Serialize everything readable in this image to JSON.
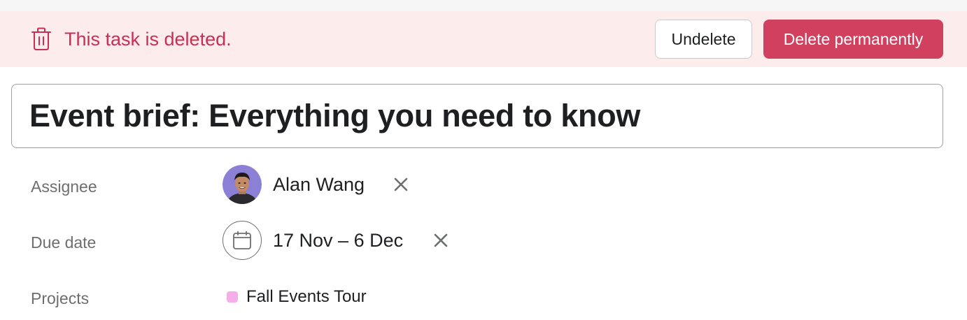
{
  "banner": {
    "message": "This task is deleted.",
    "undelete_label": "Undelete",
    "delete_label": "Delete permanently",
    "icon": "trash-icon",
    "accent_color": "#c92f54",
    "background_color": "#fdecec",
    "delete_button_color": "#d1405f"
  },
  "task": {
    "title": "Event brief: Everything you need to know"
  },
  "fields": {
    "assignee": {
      "label": "Assignee",
      "value": "Alan Wang",
      "remove_icon": "close-icon"
    },
    "due_date": {
      "label": "Due date",
      "value": "17 Nov – 6 Dec",
      "icon": "calendar-icon",
      "remove_icon": "close-icon"
    },
    "projects": {
      "label": "Projects",
      "items": [
        {
          "name": "Fall Events Tour",
          "color": "#f4aeea"
        }
      ]
    }
  }
}
